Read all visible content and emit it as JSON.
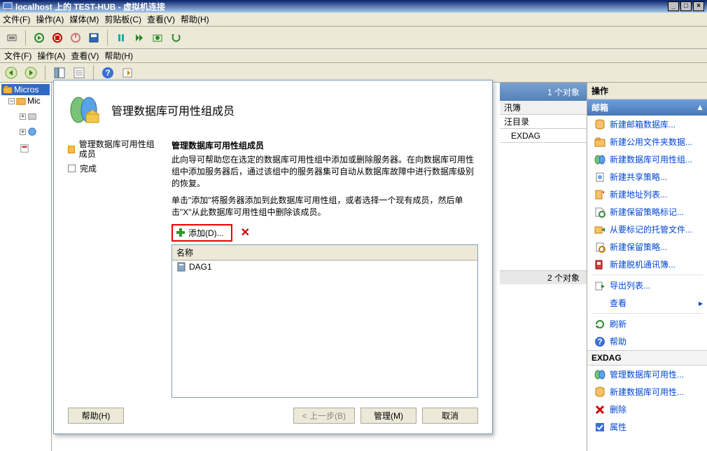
{
  "vm": {
    "title": "localhost 上的 TEST-HUB - 虚拟机连接",
    "menu": {
      "file": "文件(F)",
      "action": "操作(A)",
      "media": "媒体(M)",
      "clipboard": "剪贴板(C)",
      "view": "查看(V)",
      "help": "帮助(H)"
    }
  },
  "inner": {
    "menu": {
      "file": "文件(F)",
      "action": "操作(A)",
      "view": "查看(V)",
      "help": "帮助(H)"
    }
  },
  "tree": {
    "root": "Micros",
    "child": "Mic"
  },
  "center": {
    "obj_count1": "1 个对象",
    "tab1": "汛簿",
    "tab2": "汪目录",
    "row1": "EXDAG",
    "obj_count2": "2 个对象"
  },
  "actions": {
    "title": "操作",
    "header": "邮箱",
    "items": [
      "新建邮箱数据库...",
      "新建公用文件夹数据...",
      "新建数据库可用性组...",
      "新建共享策略...",
      "新建地址列表...",
      "新建保留策略标记...",
      "从要标记的托管文件...",
      "新建保留策略...",
      "新建脱机通讯簿...",
      "导出列表...",
      "查看",
      "刷新",
      "帮助"
    ],
    "sub_header": "EXDAG",
    "sub_items": [
      "管理数据库可用性...",
      "新建数据库可用性...",
      "删除",
      "属性"
    ]
  },
  "dialog": {
    "title": "管理数据库可用性组成员",
    "steps": {
      "s1": "管理数据库可用性组成员",
      "s2": "完成"
    },
    "right_title": "管理数据库可用性组成员",
    "desc1": "此向导可帮助您在选定的数据库可用性组中添加或删除服务器。在向数据库可用性组中添加服务器后，通过该组中的服务器集可自动从数据库故障中进行数据库级别的恢复。",
    "desc2": "单击\"添加\"将服务器添加到此数据库可用性组，或者选择一个现有成员，然后单击\"X\"从此数据库可用性组中删除该成员。",
    "add_btn": "添加(D)...",
    "list_header": "名称",
    "list_item": "DAG1",
    "btn_help": "帮助(H)",
    "btn_back": "< 上一步(B)",
    "btn_manage": "管理(M)",
    "btn_cancel": "取消"
  }
}
